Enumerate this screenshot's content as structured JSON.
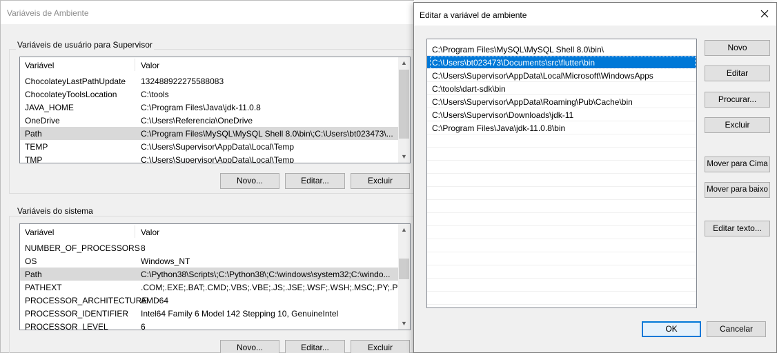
{
  "env_window": {
    "title": "Variáveis de Ambiente",
    "user_group_label": "Variáveis de usuário para Supervisor",
    "system_group_label": "Variáveis do sistema",
    "columns": {
      "variable": "Variável",
      "value": "Valor"
    },
    "user_vars": [
      {
        "name": "ChocolateyLastPathUpdate",
        "value": "132488922275588083"
      },
      {
        "name": "ChocolateyToolsLocation",
        "value": "C:\\tools"
      },
      {
        "name": "JAVA_HOME",
        "value": "C:\\Program Files\\Java\\jdk-11.0.8"
      },
      {
        "name": "OneDrive",
        "value": "C:\\Users\\Referencia\\OneDrive"
      },
      {
        "name": "Path",
        "value": "C:\\Program Files\\MySQL\\MySQL Shell 8.0\\bin\\;C:\\Users\\bt023473\\..."
      },
      {
        "name": "TEMP",
        "value": "C:\\Users\\Supervisor\\AppData\\Local\\Temp"
      },
      {
        "name": "TMP",
        "value": "C:\\Users\\Supervisor\\AppData\\Local\\Temp"
      }
    ],
    "user_selected_index": 4,
    "system_vars": [
      {
        "name": "NUMBER_OF_PROCESSORS",
        "value": "8"
      },
      {
        "name": "OS",
        "value": "Windows_NT"
      },
      {
        "name": "Path",
        "value": "C:\\Python38\\Scripts\\;C:\\Python38\\;C:\\windows\\system32;C:\\windo..."
      },
      {
        "name": "PATHEXT",
        "value": ".COM;.EXE;.BAT;.CMD;.VBS;.VBE;.JS;.JSE;.WSF;.WSH;.MSC;.PY;.PYW"
      },
      {
        "name": "PROCESSOR_ARCHITECTURE",
        "value": "AMD64"
      },
      {
        "name": "PROCESSOR_IDENTIFIER",
        "value": "Intel64 Family 6 Model 142 Stepping 10, GenuineIntel"
      },
      {
        "name": "PROCESSOR_LEVEL",
        "value": "6"
      }
    ],
    "system_selected_index": 2,
    "buttons": {
      "new": "Novo...",
      "edit": "Editar...",
      "delete": "Excluir"
    }
  },
  "edit_dialog": {
    "title": "Editar a variável de ambiente",
    "close_icon": "close-icon",
    "paths": [
      "C:\\Program Files\\MySQL\\MySQL Shell 8.0\\bin\\",
      "C:\\Users\\bt023473\\Documents\\src\\flutter\\bin",
      "C:\\Users\\Supervisor\\AppData\\Local\\Microsoft\\WindowsApps",
      "C:\\tools\\dart-sdk\\bin",
      "C:\\Users\\Supervisor\\AppData\\Roaming\\Pub\\Cache\\bin",
      "C:\\Users\\Supervisor\\Downloads\\jdk-11",
      "C:\\Program Files\\Java\\jdk-11.0.8\\bin"
    ],
    "selected_index": 1,
    "buttons": {
      "new": "Novo",
      "edit": "Editar",
      "browse": "Procurar...",
      "delete": "Excluir",
      "move_up": "Mover para Cima",
      "move_down": "Mover para baixo",
      "edit_text": "Editar texto...",
      "ok": "OK",
      "cancel": "Cancelar"
    }
  }
}
